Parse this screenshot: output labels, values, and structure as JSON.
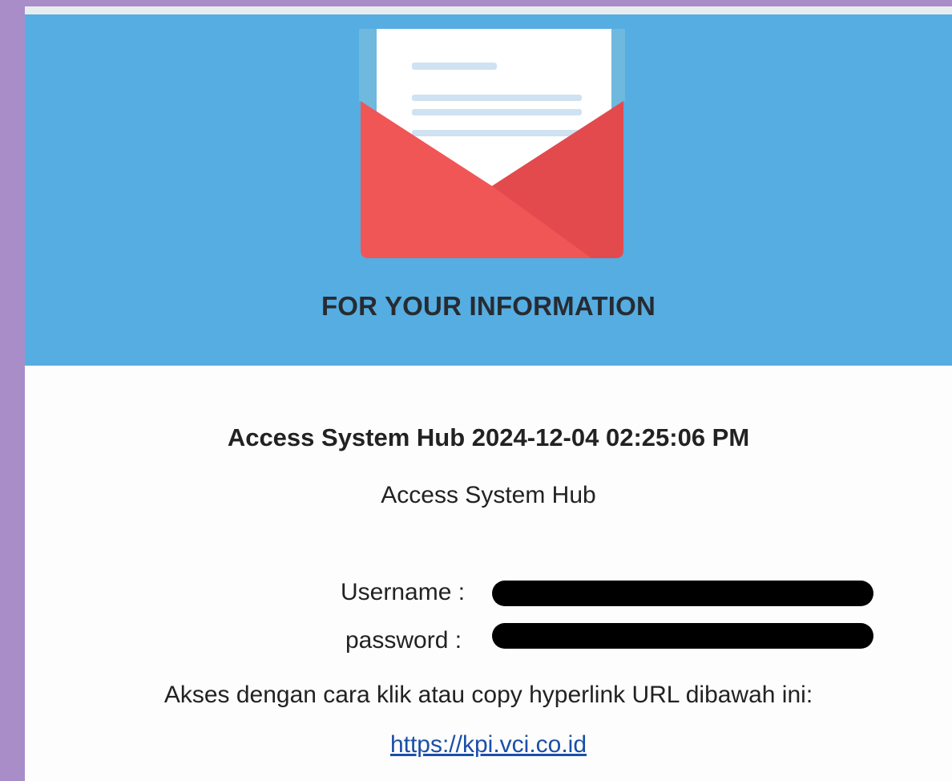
{
  "header": {
    "title": "FOR YOUR INFORMATION",
    "icon": "open-envelope-icon",
    "background_color": "#55ade1"
  },
  "message": {
    "title": "Access System Hub 2024-12-04 02:25:06 PM",
    "subtitle": "Access System Hub",
    "username_label": "Username :",
    "password_label": "password :",
    "instruction": "Akses dengan cara klik atau copy hyperlink URL dibawah ini:",
    "link_text": "https://kpi.vci.co.id",
    "link_href": "https://kpi.vci.co.id"
  },
  "colors": {
    "page_background": "#a88dc9",
    "envelope_red": "#f05656",
    "link_blue": "#1a4fa8"
  }
}
